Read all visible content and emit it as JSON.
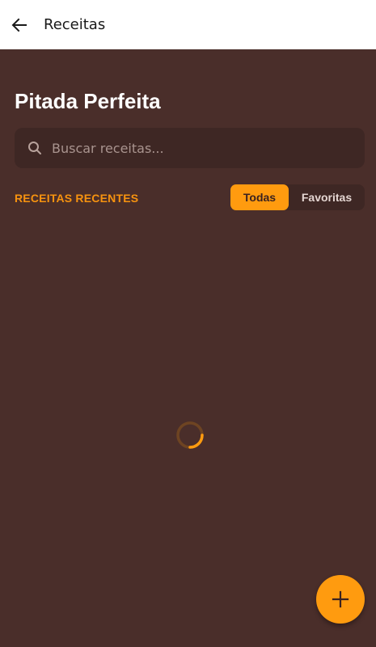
{
  "appbar": {
    "title": "Receitas",
    "back_icon": "arrow-left-icon"
  },
  "main": {
    "title": "Pitada Perfeita",
    "search": {
      "placeholder": "Buscar receitas...",
      "value": "",
      "icon": "search-icon"
    },
    "section_label": "RECEITAS RECENTES",
    "filters": [
      {
        "label": "Todas",
        "selected": true
      },
      {
        "label": "Favoritas",
        "selected": false
      }
    ],
    "loading": true
  },
  "fab": {
    "icon": "plus-icon"
  },
  "colors": {
    "background": "#4a2e2a",
    "surface": "#3e2724",
    "accent": "#ff9b0f",
    "appbar": "#ffffff"
  }
}
